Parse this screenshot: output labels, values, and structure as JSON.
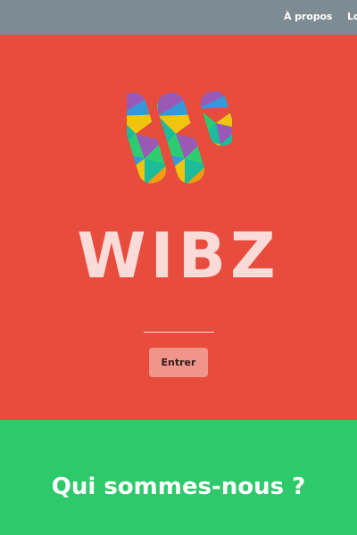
{
  "nav": {
    "about_label": "À propos",
    "next_label_partial": "Lo"
  },
  "hero": {
    "logo_icon": "wibz-w-mosaic-icon",
    "title": "WIBZ",
    "enter_label": "Entrer"
  },
  "about": {
    "heading": "Qui sommes-nous ?"
  },
  "colors": {
    "nav_bg": "#7d8b92",
    "hero_bg": "#e74c3c",
    "title": "#fadbd8",
    "button_bg": "#f1948a",
    "about_bg": "#2ec96a",
    "logo_palette": [
      "#f1c40f",
      "#e74c3c",
      "#9b59b6",
      "#3498db",
      "#1abc9c",
      "#2ecc71",
      "#f39c12"
    ]
  }
}
